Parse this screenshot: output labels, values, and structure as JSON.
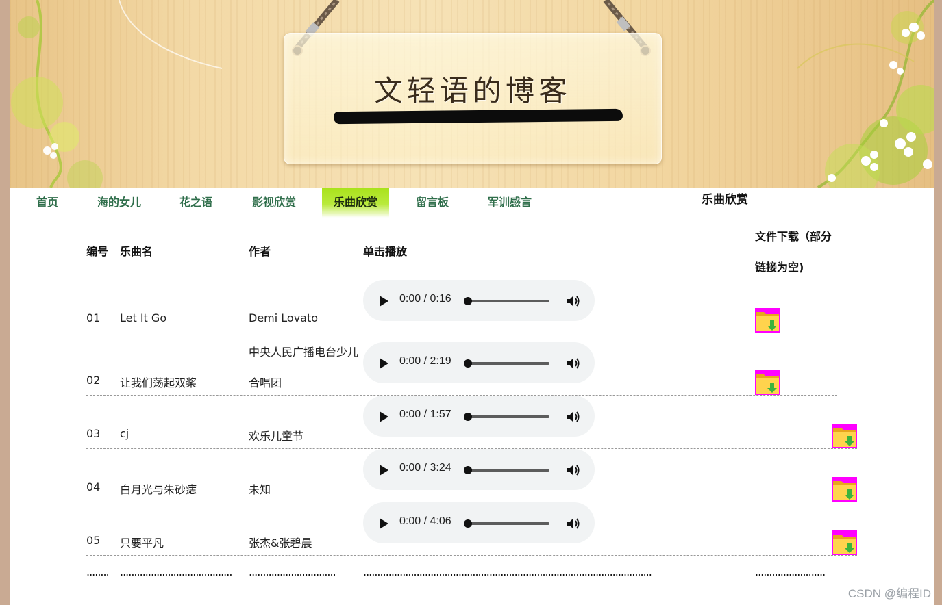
{
  "banner": {
    "title": "文轻语的博客"
  },
  "nav": {
    "items": [
      {
        "label": "首页"
      },
      {
        "label": "海的女儿"
      },
      {
        "label": "花之语"
      },
      {
        "label": "影视欣赏"
      },
      {
        "label": "乐曲欣赏",
        "active": true
      },
      {
        "label": "留言板"
      },
      {
        "label": "军训感言"
      }
    ],
    "active_color": "#a9e21b",
    "link_color": "#2f6e4b"
  },
  "section_title": "乐曲欣赏",
  "table": {
    "headers": {
      "number": "编号",
      "song": "乐曲名",
      "author": "作者",
      "play": "单击播放",
      "download_line1": "文件下载（部分",
      "download_line2": "链接为空)"
    },
    "rows": [
      {
        "number": "01",
        "song": "Let It Go",
        "author": "Demi Lovato",
        "author_line2": "",
        "time": "0:00 / 0:16"
      },
      {
        "number": "02",
        "song": "让我们荡起双桨",
        "author": "中央人民广播电台少儿",
        "author_line2": "合唱团",
        "time": "0:00 / 2:19"
      },
      {
        "number": "03",
        "song": "cj",
        "author": "欢乐儿童节",
        "author_line2": "",
        "time": "0:00 / 1:57"
      },
      {
        "number": "04",
        "song": "白月光与朱砂痣",
        "author": "未知",
        "author_line2": "",
        "time": "0:00 / 3:24"
      },
      {
        "number": "05",
        "song": "只要平凡",
        "author": "张杰&张碧晨",
        "author_line2": "",
        "time": "0:00 / 4:06"
      }
    ],
    "filler": {
      "number": "........",
      "song": "..........................................",
      "author": "...............................",
      "play": "................................................................................................................................................",
      "download": "..............................."
    }
  },
  "icons": {
    "play": "play-icon",
    "volume": "volume-icon",
    "download": "folder-download-icon"
  },
  "watermark": "CSDN @编程ID"
}
